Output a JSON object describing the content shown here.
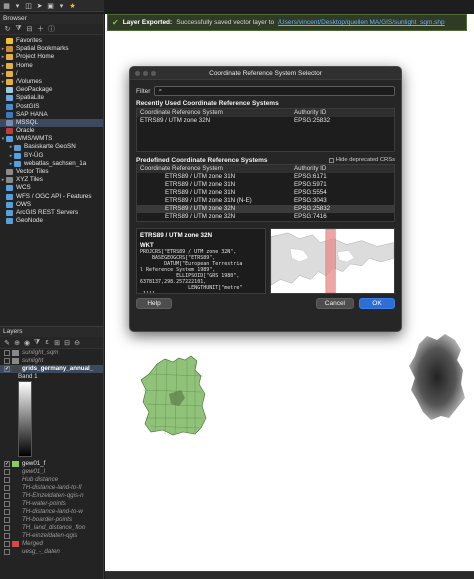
{
  "colors": {
    "accent": "#2e6fd6",
    "success": "#7ec24a",
    "link": "#6ab0ff",
    "germany_fill": "#90c27a"
  },
  "toolbar": {
    "icons": [
      "grid-icon",
      "arrow-icon",
      "layers-icon",
      "cursor-icon",
      "lock-icon",
      "dropdown-icon",
      "star-icon"
    ]
  },
  "browser": {
    "title": "Browser",
    "items": [
      {
        "label": "Favorites",
        "icon": "star-icon",
        "color": "#f2c230",
        "arrow": ""
      },
      {
        "label": "Spatial Bookmarks",
        "icon": "bookmark-icon",
        "color": "#c98a3a",
        "arrow": "▸"
      },
      {
        "label": "Project Home",
        "icon": "folder-icon",
        "color": "#e0b040",
        "arrow": "▸"
      },
      {
        "label": "Home",
        "icon": "folder-icon",
        "color": "#e0b040",
        "arrow": "▸"
      },
      {
        "label": "/",
        "icon": "folder-icon",
        "color": "#e0b040",
        "arrow": "▸"
      },
      {
        "label": "/Volumes",
        "icon": "folder-icon",
        "color": "#e0b040",
        "arrow": "▸"
      },
      {
        "label": "GeoPackage",
        "icon": "geopackage-icon",
        "color": "#9bc9e8",
        "arrow": ""
      },
      {
        "label": "SpatiaLite",
        "icon": "spatialite-icon",
        "color": "#6fa8dc",
        "arrow": ""
      },
      {
        "label": "PostGIS",
        "icon": "postgis-icon",
        "color": "#4c8cc8",
        "arrow": ""
      },
      {
        "label": "SAP HANA",
        "icon": "saphana-icon",
        "color": "#3c7ac0",
        "arrow": ""
      },
      {
        "label": "MSSQL",
        "icon": "mssql-icon",
        "color": "#7a8aa8",
        "arrow": "",
        "selected": true
      },
      {
        "label": "Oracle",
        "icon": "oracle-icon",
        "color": "#c03c3c",
        "arrow": ""
      },
      {
        "label": "WMS/WMTS",
        "icon": "wms-icon",
        "color": "#5aa0d8",
        "arrow": "▾"
      },
      {
        "label": "Basiskarte GeoSN",
        "icon": "wms-icon",
        "color": "#5aa0d8",
        "arrow": "▸",
        "indent": true
      },
      {
        "label": "BY-ÜG",
        "icon": "wms-icon",
        "color": "#5aa0d8",
        "arrow": "▸",
        "indent": true
      },
      {
        "label": "webatlas_sachsen_1a",
        "icon": "wms-icon",
        "color": "#5aa0d8",
        "arrow": "▸",
        "indent": true
      },
      {
        "label": "Vector Tiles",
        "icon": "vectortiles-icon",
        "color": "#8a8a8a",
        "arrow": ""
      },
      {
        "label": "XYZ Tiles",
        "icon": "xyz-icon",
        "color": "#8a8a8a",
        "arrow": "▸"
      },
      {
        "label": "WCS",
        "icon": "wcs-icon",
        "color": "#5aa0d8",
        "arrow": ""
      },
      {
        "label": "WFS / OGC API - Features",
        "icon": "wfs-icon",
        "color": "#5aa0d8",
        "arrow": ""
      },
      {
        "label": "OWS",
        "icon": "ows-icon",
        "color": "#5aa0d8",
        "arrow": ""
      },
      {
        "label": "ArcGIS REST Servers",
        "icon": "arcgis-icon",
        "color": "#5aa0d8",
        "arrow": ""
      },
      {
        "label": "GeoNode",
        "icon": "geonode-icon",
        "color": "#5aa0d8",
        "arrow": ""
      }
    ]
  },
  "layers": {
    "title": "Layers",
    "items": [
      {
        "label": "sunlight_sqm",
        "style": "dim",
        "swatch": "#888888",
        "checked": false
      },
      {
        "label": "sunlight",
        "style": "dim",
        "swatch": "#888888",
        "checked": false
      },
      {
        "label": "grids_germany_annual_",
        "style": "bold",
        "swatch": "#444444",
        "checked": true
      }
    ],
    "band_label": "Band 1",
    "items2": [
      {
        "label": "gew01_f",
        "style": "normal",
        "swatch": "#8bc86a",
        "checked": true
      },
      {
        "label": "gew01_l",
        "style": "dim",
        "swatch": "",
        "checked": false
      },
      {
        "label": "Hub distance",
        "style": "dim",
        "swatch": "",
        "checked": false
      },
      {
        "label": "TH-distance-land-to-fl",
        "style": "dim",
        "swatch": "",
        "checked": false
      },
      {
        "label": "TH-Einzeldaten-qgis-n",
        "style": "dim",
        "swatch": "",
        "checked": false
      },
      {
        "label": "TH-water-points",
        "style": "dim",
        "swatch": "",
        "checked": false
      },
      {
        "label": "TH-distance-land-to-w",
        "style": "dim",
        "swatch": "",
        "checked": false
      },
      {
        "label": "TH-boarder-points",
        "style": "dim",
        "swatch": "",
        "checked": false
      },
      {
        "label": "TH_land_distance_floo",
        "style": "dim",
        "swatch": "",
        "checked": false
      },
      {
        "label": "TH-einzeldaten-qgis",
        "style": "dim",
        "swatch": "",
        "checked": false
      },
      {
        "label": "Merged",
        "style": "dim",
        "swatch": "#d04a4a",
        "checked": false
      },
      {
        "label": "uesg_-_daten",
        "style": "dim",
        "swatch": "",
        "checked": false
      }
    ]
  },
  "message": {
    "title": "Layer Exported:",
    "text": "Successfully saved vector layer to",
    "link": "/Users/vincent/Desktop/quellen MA/GIS/sunlight_sqm.shp"
  },
  "dialog": {
    "title": "Coordinate Reference System Selector",
    "filter_label": "Filter",
    "filter_value": "",
    "recent_title": "Recently Used Coordinate Reference Systems",
    "col_crs": "Coordinate Reference System",
    "col_authority": "Authority ID",
    "recent_rows": [
      {
        "crs": "ETRS89 / UTM zone 32N",
        "auth": "EPSG:25832"
      }
    ],
    "predef_title": "Predefined Coordinate Reference Systems",
    "hide_deprecated": "Hide deprecated CRSs",
    "predef_rows": [
      {
        "crs": "ETRS89 / UTM zone 31N",
        "auth": "EPSG:6171"
      },
      {
        "crs": "ETRS89 / UTM zone 31N",
        "auth": "EPSG:5971"
      },
      {
        "crs": "ETRS89 / UTM zone 31N",
        "auth": "EPSG:5554"
      },
      {
        "crs": "ETRS89 / UTM zone 31N (N-E)",
        "auth": "EPSG:3043"
      },
      {
        "crs": "ETRS89 / UTM zone 32N",
        "auth": "EPSG:25832",
        "selected": true
      },
      {
        "crs": "ETRS89 / UTM zone 32N",
        "auth": "EPSG:7416"
      }
    ],
    "detail_title": "ETRS89 / UTM zone 32N",
    "wkt_label": "WKT",
    "wkt_text": "PROJCRS[\"ETRS89 / UTM zone 32N\",\n    BASEGEOGCRS[\"ETRS89\",\n        DATUM[\"European Terrestria\nl Reference System 1989\",\n            ELLIPSOID[\"GRS 1980\",\n6378137,298.257222101,\n                LENGTHUNIT[\"metre\"\n,1]]],",
    "help_label": "Help",
    "cancel_label": "Cancel",
    "ok_label": "OK"
  }
}
